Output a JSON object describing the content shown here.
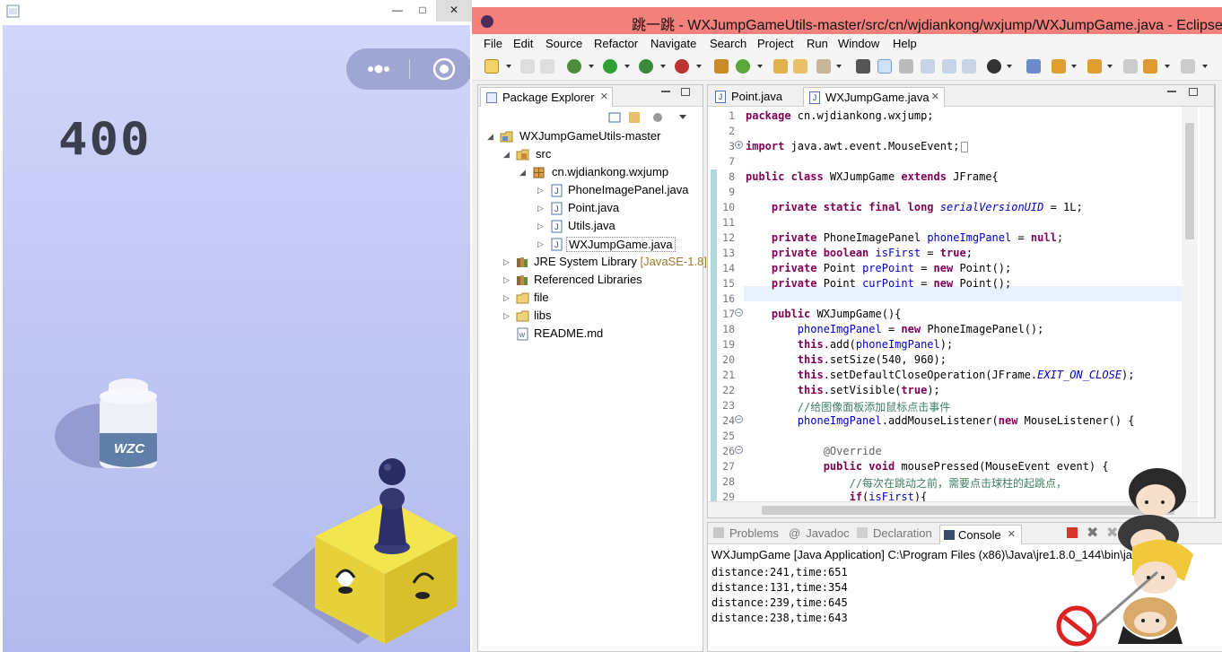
{
  "game": {
    "score": "400",
    "bottle_label": "WZC"
  },
  "eclipse": {
    "title": "跳一跳 - WXJumpGameUtils-master/src/cn/wjdiankong/wxjump/WXJumpGame.java - Eclipse",
    "menu": [
      "File",
      "Edit",
      "Source",
      "Refactor",
      "Navigate",
      "Search",
      "Project",
      "Run",
      "Window",
      "Help"
    ],
    "package_explorer": {
      "tab_label": "Package Explorer",
      "project": "WXJumpGameUtils-master",
      "src": "src",
      "package": "cn.wjdiankong.wxjump",
      "files": [
        "PhoneImagePanel.java",
        "Point.java",
        "Utils.java",
        "WXJumpGame.java"
      ],
      "jre": "JRE System Library",
      "jre_decor": "[JavaSE-1.8]",
      "ref_libs": "Referenced Libraries",
      "folder_file": "file",
      "folder_libs": "libs",
      "readme": "README.md"
    },
    "editor": {
      "tabs": [
        "Point.java",
        "WXJumpGame.java"
      ],
      "line_numbers": [
        "1",
        "2",
        "3",
        "7",
        "8",
        "9",
        "10",
        "11",
        "12",
        "13",
        "14",
        "15",
        "16",
        "17",
        "18",
        "19",
        "20",
        "21",
        "22",
        "23",
        "24",
        "25",
        "26",
        "27",
        "28",
        "29"
      ],
      "lines": {
        "l1_kw": "package",
        "l1_rest": " cn.wjdiankong.wxjump;",
        "l3_kw": "import",
        "l3_rest": " java.awt.event.MouseEvent;",
        "l8_kw1": "public class",
        "l8_mid": " WXJumpGame ",
        "l8_kw2": "extends",
        "l8_rest": " JFrame{",
        "l10_kw": "private static final long",
        "l10_field": "serialVersionUID",
        "l10_rest": " = 1L;",
        "l12_kw": "private",
        "l12_type": " PhoneImagePanel ",
        "l12_field": "phoneImgPanel",
        "l12_eq": " = ",
        "l12_kw2": "null",
        "l12_end": ";",
        "l13_kw": "private boolean",
        "l13_field": "isFirst",
        "l13_eq": " = ",
        "l13_kw2": "true",
        "l13_end": ";",
        "l14_kw": "private",
        "l14_type": " Point ",
        "l14_field": "prePoint",
        "l14_eq": " = ",
        "l14_kw2": "new",
        "l14_end": " Point();",
        "l15_kw": "private",
        "l15_type": " Point ",
        "l15_field": "curPoint",
        "l15_eq": " = ",
        "l15_kw2": "new",
        "l15_end": " Point();",
        "l17_kw": "public",
        "l17_rest": " WXJumpGame(){",
        "l18_field": "phoneImgPanel",
        "l18_eq": " = ",
        "l18_kw": "new",
        "l18_rest": " PhoneImagePanel();",
        "l19_kw": "this",
        "l19_mid": ".add(",
        "l19_field": "phoneImgPanel",
        "l19_end": ");",
        "l20_kw": "this",
        "l20_rest": ".setSize(540, 960);",
        "l21_kw": "this",
        "l21_mid": ".setDefaultCloseOperation(JFrame.",
        "l21_const": "EXIT_ON_CLOSE",
        "l21_end": ");",
        "l22_kw": "this",
        "l22_mid": ".setVisible(",
        "l22_kw2": "true",
        "l22_end": ");",
        "l23_comment": "//给图像面板添加鼠标点击事件",
        "l24_field": "phoneImgPanel",
        "l24_mid": ".addMouseListener(",
        "l24_kw": "new",
        "l24_rest": " MouseListener() {",
        "l26_anno": "@Override",
        "l27_kw": "public void",
        "l27_rest": " mousePressed(MouseEvent event) {",
        "l28_comment": "//每次在跳动之前，需要点击球柱的起跳点，",
        "l29_kw": "if",
        "l29_mid": "(",
        "l29_field": "isFirst",
        "l29_end": "){"
      }
    },
    "console": {
      "tabs": [
        "Problems",
        "Javadoc",
        "Declaration",
        "Console"
      ],
      "header": "WXJumpGame [Java Application] C:\\Program Files (x86)\\Java\\jre1.8.0_144\\bin\\jav",
      "output": [
        "distance:241,time:651",
        "distance:131,time:354",
        "distance:239,time:645",
        "distance:238,time:643"
      ]
    }
  }
}
